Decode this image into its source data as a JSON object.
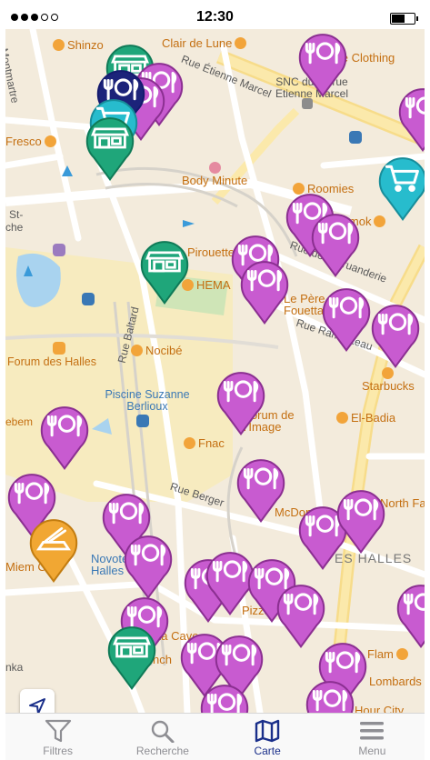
{
  "status": {
    "time": "12:30"
  },
  "map": {
    "streets": [
      {
        "text": "Montmartre"
      },
      {
        "text": "Rue Étienne Marcel"
      },
      {
        "text": "Rue Baltard"
      },
      {
        "text": "Rue Berger"
      },
      {
        "text": "Rue de la Truanderie"
      },
      {
        "text": "Rue Rambuteau"
      }
    ],
    "places": [
      {
        "text": "SNC du 16 rue Etienne Marcel"
      },
      {
        "text": "Forum des Halles"
      },
      {
        "text": "Piscine Suzanne Berlioux"
      },
      {
        "text": "ES HALLES"
      },
      {
        "text": "St-"
      },
      {
        "text": "che"
      },
      {
        "text": "ebem"
      },
      {
        "text": "nka"
      }
    ],
    "pois": [
      {
        "text": "Shinzo"
      },
      {
        "text": "Clair de Lune"
      },
      {
        "text": "Episode Clothing"
      },
      {
        "text": "Fresco"
      },
      {
        "text": "Body Minute"
      },
      {
        "text": "Roomies"
      },
      {
        "text": "Pirouette"
      },
      {
        "text": "HEMA"
      },
      {
        "text": "Nocibé"
      },
      {
        "text": "Le Père Fouettard"
      },
      {
        "text": "Starbucks"
      },
      {
        "text": "El-Badia"
      },
      {
        "text": "Fnac"
      },
      {
        "text": "Forum de l'Image"
      },
      {
        "text": "McDonald's"
      },
      {
        "text": "North Face"
      },
      {
        "text": "Novotel Les Halles"
      },
      {
        "text": "La Cave"
      },
      {
        "text": "Pizza"
      },
      {
        "text": "Lombards"
      },
      {
        "text": "Flam"
      },
      {
        "text": "Flunch"
      },
      {
        "text": "Hour City"
      },
      {
        "text": "Kamok"
      },
      {
        "text": "Miem C"
      }
    ]
  },
  "colors": {
    "restaurant": "#c85bd0",
    "shop": "#1fa67a",
    "grocery": "#27bccd",
    "bakery": "#f1a733",
    "accent": "#1a2f8a"
  },
  "tabs": [
    {
      "label": "Filtres",
      "icon": "filter-icon"
    },
    {
      "label": "Recherche",
      "icon": "search-icon"
    },
    {
      "label": "Carte",
      "icon": "map-icon"
    },
    {
      "label": "Menu",
      "icon": "menu-icon"
    }
  ]
}
